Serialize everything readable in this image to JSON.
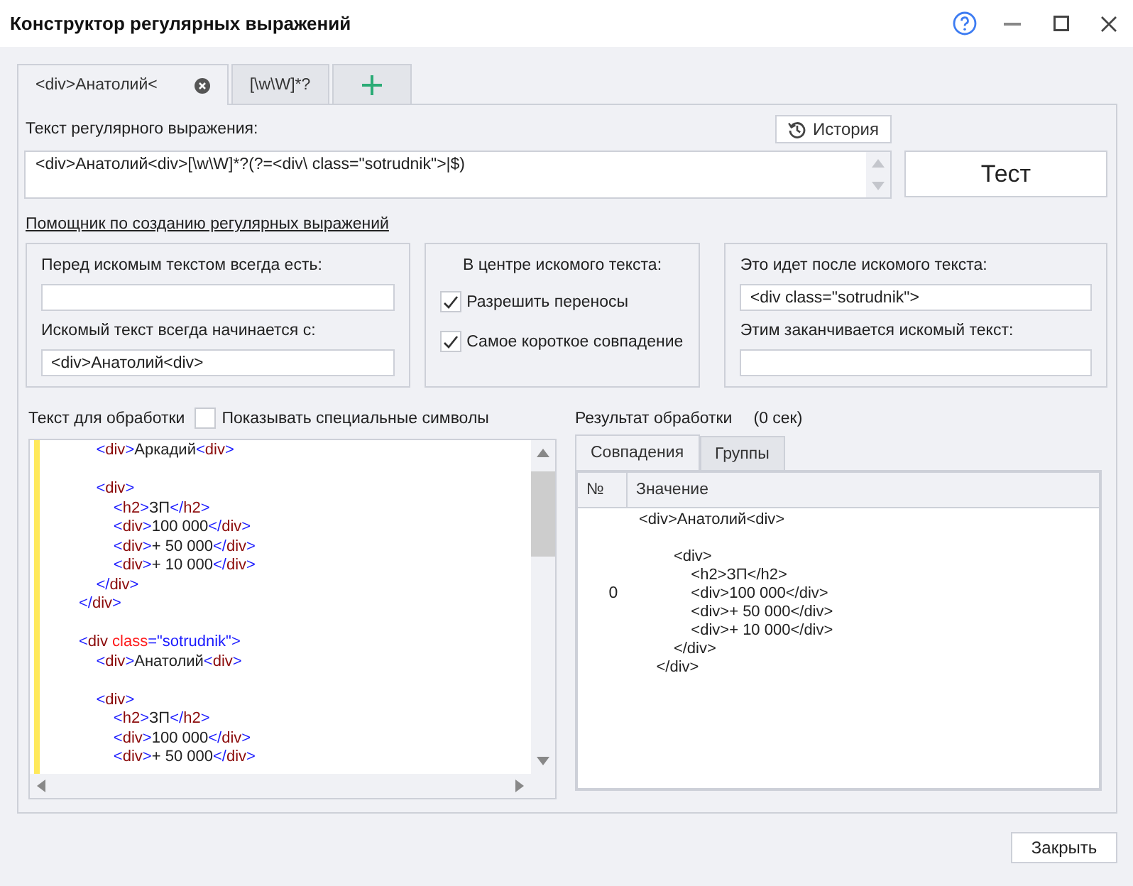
{
  "window": {
    "title": "Конструктор регулярных выражений"
  },
  "tabs": [
    {
      "label": "<div>Анатолий<",
      "selected": true,
      "closable": true
    },
    {
      "label": "[\\w\\W]*?",
      "selected": false,
      "closable": false
    }
  ],
  "regex": {
    "label": "Текст регулярного выражения:",
    "history_button": "История",
    "value": "<div>Анатолий<div>[\\w\\W]*?(?=<div\\ class=\"sotrudnik\">|$)",
    "test_button": "Тест"
  },
  "helper_link": "Помощник по созданию регулярных выражений",
  "before_group": {
    "before_label": "Перед искомым текстом всегда есть:",
    "starts_label": "Искомый текст всегда начинается с:",
    "starts_value": "<div>Анатолий<div>"
  },
  "center_group": {
    "title": "В центре искомого текста:",
    "options": [
      {
        "label": "Разрешить переносы",
        "checked": true
      },
      {
        "label": "Самое короткое совпадение",
        "checked": true
      }
    ]
  },
  "after_group": {
    "after_label": "Это идет после искомого текста:",
    "after_value": "<div class=\"sotrudnik\">",
    "ends_label": "Этим заканчивается искомый текст:"
  },
  "source": {
    "label": "Текст для обработки",
    "show_special": {
      "label": "Показывать специальные символы",
      "checked": false
    },
    "text": "            <div>Аркадий<div>\n\n            <div>\n                <h2>ЗП</h2>\n                <div>100 000</div>\n                <div>+ 50 000</div>\n                <div>+ 10 000</div>\n            </div>\n        </div>\n\n        <div class=\"sotrudnik\">\n            <div>Анатолий<div>\n\n            <div>\n                <h2>ЗП</h2>\n                <div>100 000</div>\n                <div>+ 50 000</div>"
  },
  "result": {
    "label": "Результат обработки",
    "time": "(0 сек)",
    "tabs": [
      {
        "label": "Совпадения",
        "selected": true
      },
      {
        "label": "Группы",
        "selected": false
      }
    ],
    "columns": [
      "№",
      "Значение"
    ],
    "rows": [
      {
        "number": "0",
        "value": "<div>Анатолий<div>\n\n        <div>\n            <h2>ЗП</h2>\n            <div>100 000</div>\n            <div>+ 50 000</div>\n            <div>+ 10 000</div>\n        </div>\n    </div>"
      }
    ]
  },
  "close_button": "Закрыть"
}
